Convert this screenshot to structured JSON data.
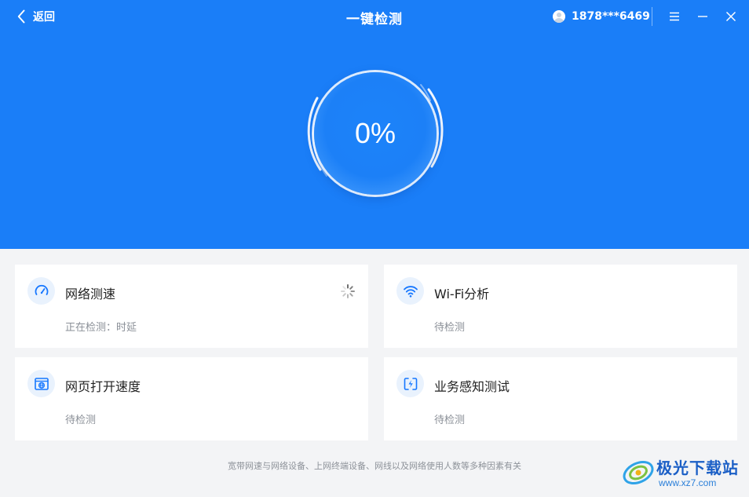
{
  "titlebar": {
    "back_label": "返回",
    "title": "一键检测",
    "user_phone": "1878***6469"
  },
  "gauge": {
    "progress_text": "0%",
    "progress_value": 0
  },
  "cards": [
    {
      "title": "网络测速",
      "status": "正在检测：时延",
      "icon": "speedometer-icon",
      "loading": true
    },
    {
      "title": "Wi-Fi分析",
      "status": "待检测",
      "icon": "wifi-icon",
      "loading": false
    },
    {
      "title": "网页打开速度",
      "status": "待检测",
      "icon": "browser-globe-icon",
      "loading": false
    },
    {
      "title": "业务感知测试",
      "status": "待检测",
      "icon": "service-bolt-icon",
      "loading": false
    }
  ],
  "footnote": "宽带网速与网络设备、上网终端设备、网线以及网络使用人数等多种因素有关",
  "watermark": {
    "name": "极光下载站",
    "url": "www.xz7.com"
  },
  "colors": {
    "header_blue": "#1a7ef8",
    "accent_blue": "#1677ff",
    "background": "#f3f4f6"
  }
}
